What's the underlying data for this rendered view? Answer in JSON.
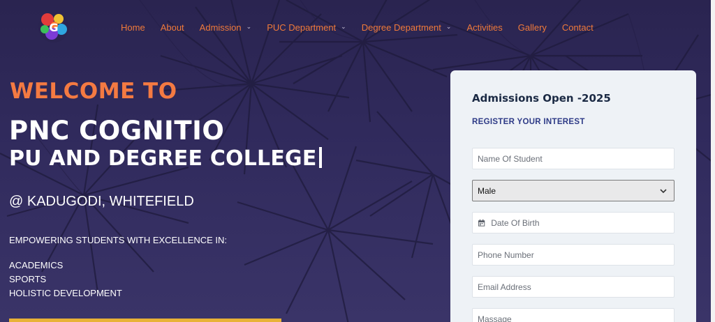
{
  "nav": {
    "items": [
      {
        "label": "Home",
        "dropdown": false
      },
      {
        "label": "About",
        "dropdown": false
      },
      {
        "label": "Admission",
        "dropdown": true
      },
      {
        "label": "PUC Department",
        "dropdown": true
      },
      {
        "label": "Degree Department",
        "dropdown": true
      },
      {
        "label": "Activities",
        "dropdown": false
      },
      {
        "label": "Gallery",
        "dropdown": false
      },
      {
        "label": "Contact",
        "dropdown": false
      }
    ],
    "chevron": "⌄"
  },
  "hero": {
    "welcome": "WELCOME TO",
    "name_line1": "PNC COGNITIO",
    "name_line2": "PU AND DEGREE COLLEGE",
    "location": "@ KADUGODI, WHITEFIELD",
    "empower": "EMPOWERING STUDENTS WITH EXCELLENCE IN:",
    "pillars": [
      "ACADEMICS",
      "SPORTS",
      "HOLISTIC DEVELOPMENT"
    ]
  },
  "form": {
    "title": "Admissions Open -2025",
    "subtitle": "REGISTER YOUR INTEREST",
    "name_placeholder": "Name Of Student",
    "gender_value": "Male",
    "dob_placeholder": "Date Of Birth",
    "phone_placeholder": "Phone Number",
    "email_placeholder": "Email Address",
    "message_placeholder": "Massage"
  },
  "colors": {
    "nav_text": "#f07a3a",
    "welcome": "#f47a42",
    "hero_bg": "#2d2856",
    "card_bg": "#eef2f6",
    "accent_bar": "#e8b237",
    "form_subtitle": "#2d3a86"
  },
  "icons": {
    "logo": "college-logo-icon",
    "calendar": "calendar-icon",
    "select_arrow": "chevron-down-icon"
  }
}
